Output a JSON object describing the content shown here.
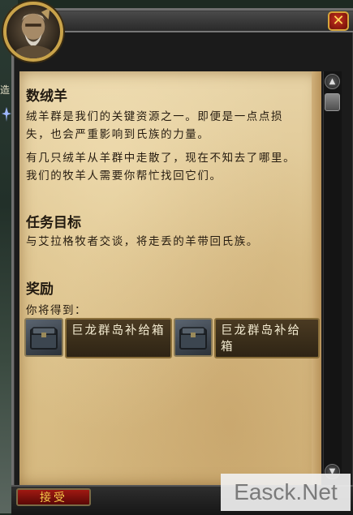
{
  "backdrop": {
    "edge_char": "造"
  },
  "window": {
    "close_glyph": "✕"
  },
  "quest": {
    "title": "数绒羊",
    "description_1": "绒羊群是我们的关键资源之一。即便是一点点损失，也会严重影响到氏族的力量。",
    "description_2": "有几只绒羊从羊群中走散了，现在不知去了哪里。我们的牧羊人需要你帮忙找回它们。",
    "objectives_heading": "任务目标",
    "objectives_text": "与艾拉格牧者交谈，将走丢的羊带回氏族。",
    "rewards_heading": "奖励",
    "rewards_sub": "你将得到：",
    "rewards": [
      {
        "name": "巨龙群岛补给箱",
        "icon": "chest-icon"
      },
      {
        "name": "巨龙群岛补给箱",
        "icon": "chest-icon"
      }
    ]
  },
  "buttons": {
    "accept_label": "接受"
  },
  "watermark": "Easck.Net",
  "colors": {
    "parchment": "#dcc28c",
    "frame_gold": "#c9a34a",
    "accept_red": "#a01a12",
    "accept_text": "#f3c84a"
  }
}
